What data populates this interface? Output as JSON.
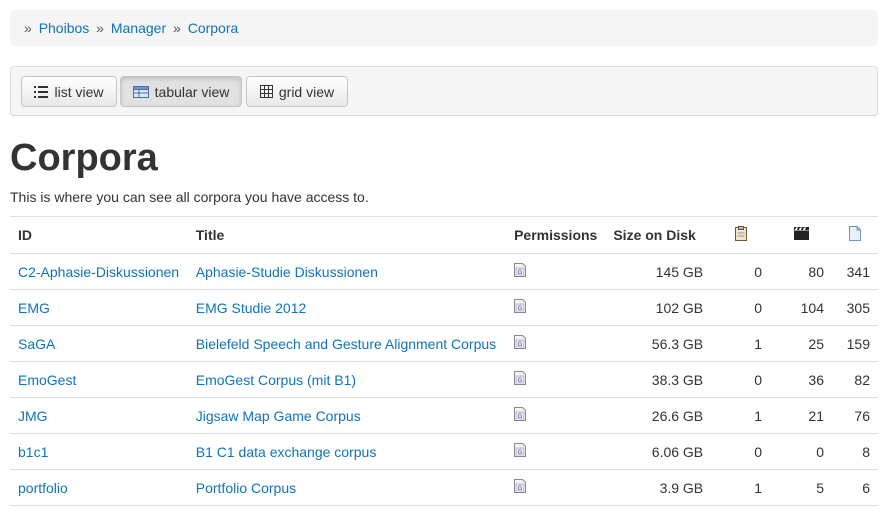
{
  "breadcrumb": {
    "separator": "»",
    "items": [
      "Phoibos",
      "Manager",
      "Corpora"
    ]
  },
  "toolbar": {
    "list_view": "list view",
    "tabular_view": "tabular view",
    "grid_view": "grid view",
    "active": "tabular_view"
  },
  "page": {
    "title": "Corpora",
    "intro": "This is where you can see all corpora you have access to."
  },
  "table": {
    "headers": {
      "id": "ID",
      "title": "Title",
      "permissions": "Permissions",
      "size": "Size on Disk",
      "col_a_icon": "clipboard-icon",
      "col_b_icon": "film-icon",
      "col_c_icon": "document-icon"
    },
    "rows": [
      {
        "id": "C2-Aphasie-Diskussionen",
        "title": "Aphasie-Studie Diskussionen",
        "permissions_icon": "permissions-icon",
        "size": "145 GB",
        "a": "0",
        "b": "80",
        "c": "341"
      },
      {
        "id": "EMG",
        "title": "EMG Studie 2012",
        "permissions_icon": "permissions-icon",
        "size": "102 GB",
        "a": "0",
        "b": "104",
        "c": "305"
      },
      {
        "id": "SaGA",
        "title": "Bielefeld Speech and Gesture Alignment Corpus",
        "permissions_icon": "permissions-icon",
        "size": "56.3 GB",
        "a": "1",
        "b": "25",
        "c": "159"
      },
      {
        "id": "EmoGest",
        "title": "EmoGest Corpus (mit B1)",
        "permissions_icon": "permissions-icon",
        "size": "38.3 GB",
        "a": "0",
        "b": "36",
        "c": "82"
      },
      {
        "id": "JMG",
        "title": "Jigsaw Map Game Corpus",
        "permissions_icon": "permissions-icon",
        "size": "26.6 GB",
        "a": "1",
        "b": "21",
        "c": "76"
      },
      {
        "id": "b1c1",
        "title": "B1 C1 data exchange corpus",
        "permissions_icon": "permissions-icon",
        "size": "6.06 GB",
        "a": "0",
        "b": "0",
        "c": "8"
      },
      {
        "id": "portfolio",
        "title": "Portfolio Corpus",
        "permissions_icon": "permissions-icon",
        "size": "3.9 GB",
        "a": "1",
        "b": "5",
        "c": "6"
      }
    ]
  },
  "colors": {
    "link": "#0f74b8",
    "text": "#333333",
    "panel_bg": "#f5f5f5"
  }
}
